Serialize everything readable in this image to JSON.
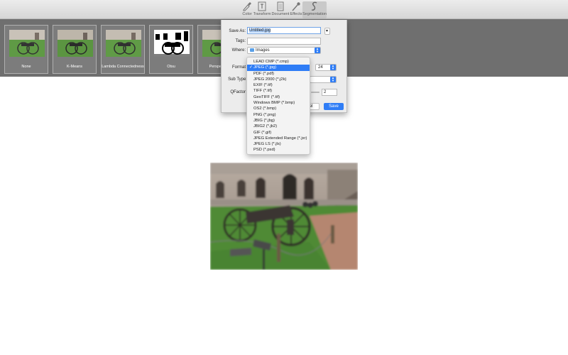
{
  "toolbar": {
    "tools": [
      {
        "label": "Color",
        "icon": "eyedropper-icon"
      },
      {
        "label": "Transform",
        "icon": "transform-icon"
      },
      {
        "label": "Document",
        "icon": "document-icon"
      },
      {
        "label": "Effects",
        "icon": "effects-wand-icon"
      },
      {
        "label": "Segmentation",
        "icon": "segmentation-icon"
      }
    ],
    "active": "Segmentation"
  },
  "thumbnails": [
    {
      "label": "None"
    },
    {
      "label": "K-Means"
    },
    {
      "label": "Lambda Connectedness"
    },
    {
      "label": "Otsu"
    },
    {
      "label": "Perspective"
    }
  ],
  "dialog": {
    "save_as_label": "Save As:",
    "save_as_value": "Untitled.jpg",
    "tags_label": "Tags:",
    "tags_value": "",
    "where_label": "Where:",
    "where_value": "Images",
    "format_label": "Format",
    "subtype_label": "Sub Type:",
    "qfactor_label": "QFactor",
    "bits_label": "P",
    "bits_value": "24",
    "qfactor_value": "2",
    "cancel_label": "ncel",
    "save_label": "Save"
  },
  "format_menu": {
    "selected": "JPEG (*.jpg)",
    "items": [
      "LEAD CMP (*.cmp)",
      "JPEG (*.jpg)",
      "PDF (*.pdf)",
      "JPEG 2000 (*.j2k)",
      "EXIF (*.tif)",
      "TIFF (*.tif)",
      "GeoTIFF (*.tif)",
      "Windows BMP (*.bmp)",
      "OS2 (*.bmp)",
      "PNG (*.png)",
      "JBIG (*.jbg)",
      "JBIG2 (*.jb2)",
      "GIF (*.gif)",
      "JPEG Extended Range (*.jxr)",
      "JPEG LS (*.jls)",
      "PSD (*.psd)"
    ]
  },
  "colors": {
    "accent": "#2f7df6",
    "strip": "#6f6f6f"
  }
}
